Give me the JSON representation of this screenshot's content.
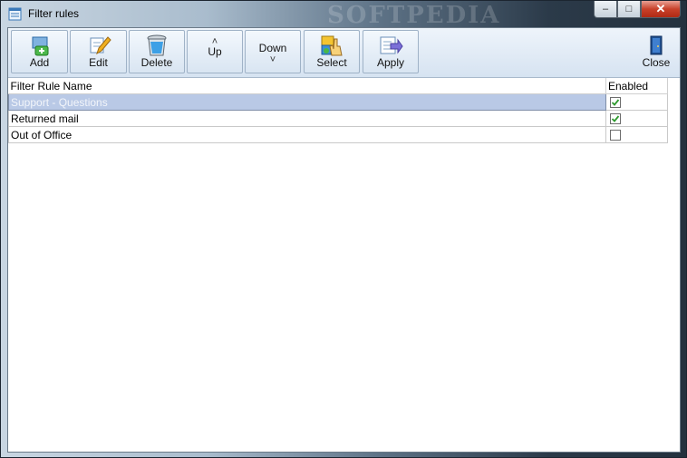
{
  "window": {
    "title": "Filter rules",
    "watermark": "SOFTPEDIA"
  },
  "caption": {
    "minimize": "–",
    "maximize": "□",
    "close": "✕"
  },
  "toolbar": {
    "add": "Add",
    "edit": "Edit",
    "delete": "Delete",
    "up": "Up",
    "down": "Down",
    "select": "Select",
    "apply": "Apply",
    "close": "Close",
    "up_arrow": "˄",
    "down_arrow": "˅"
  },
  "grid": {
    "columns": [
      "Filter Rule Name",
      "Enabled"
    ],
    "rows": [
      {
        "name": "Support - Questions",
        "enabled": true
      },
      {
        "name": "Returned mail",
        "enabled": true
      },
      {
        "name": "Out of Office",
        "enabled": false
      }
    ]
  },
  "colors": {
    "accent": "#b9c9e6",
    "check": "#2e9a2e"
  }
}
